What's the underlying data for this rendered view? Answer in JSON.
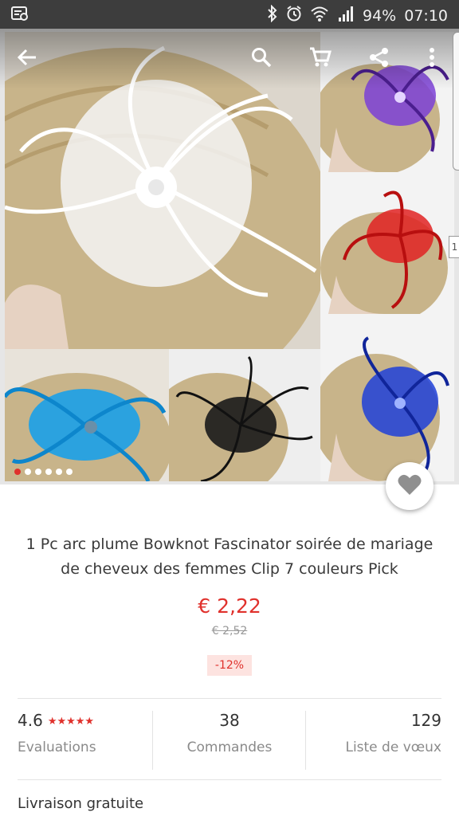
{
  "status_bar": {
    "battery": "94%",
    "time": "07:10"
  },
  "toolbar": {
    "back_icon": "arrow-back-icon",
    "search_icon": "search-icon",
    "cart_icon": "cart-icon",
    "share_icon": "share-icon",
    "more_icon": "more-vert-icon"
  },
  "gallery": {
    "image_count": 6,
    "active_index": 0,
    "side_counter": "1",
    "colors": [
      "#f4f4f4",
      "#7b3fd6",
      "#e02222",
      "#1aa0e8",
      "#1a1a1a",
      "#1f3fd8"
    ]
  },
  "product": {
    "title": "1 Pc arc plume Bowknot Fascinator soirée de mariage de cheveux des femmes Clip 7 couleurs Pick",
    "price": "€ 2,22",
    "old_price": "€ 2,52",
    "discount": "-12%"
  },
  "stats": {
    "rating": "4.6",
    "stars": "★★★★★",
    "evaluations_label": "Evaluations",
    "orders": "38",
    "orders_label": "Commandes",
    "wishlist": "129",
    "wishlist_label": "Liste de vœux"
  },
  "shipping": {
    "label": "Livraison gratuite"
  },
  "accent_color": "#e0312c"
}
